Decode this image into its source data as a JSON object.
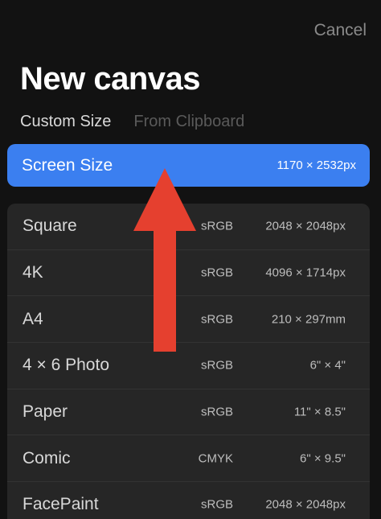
{
  "header": {
    "cancel_label": "Cancel",
    "title": "New canvas"
  },
  "tabs": {
    "custom_size": "Custom Size",
    "from_clipboard": "From Clipboard"
  },
  "screen_size": {
    "label": "Screen Size",
    "dims": "1170 × 2532px"
  },
  "presets": [
    {
      "name": "Square",
      "space": "sRGB",
      "size": "2048 × 2048px"
    },
    {
      "name": "4K",
      "space": "sRGB",
      "size": "4096 × 1714px"
    },
    {
      "name": "A4",
      "space": "sRGB",
      "size": "210 × 297mm"
    },
    {
      "name": "4 × 6 Photo",
      "space": "sRGB",
      "size": "6\" × 4\""
    },
    {
      "name": "Paper",
      "space": "sRGB",
      "size": "11\" × 8.5\""
    },
    {
      "name": "Comic",
      "space": "CMYK",
      "size": "6\" × 9.5\""
    },
    {
      "name": "FacePaint",
      "space": "sRGB",
      "size": "2048 × 2048px"
    }
  ],
  "colors": {
    "accent": "#3b7ff0",
    "arrow": "#e5402f"
  }
}
